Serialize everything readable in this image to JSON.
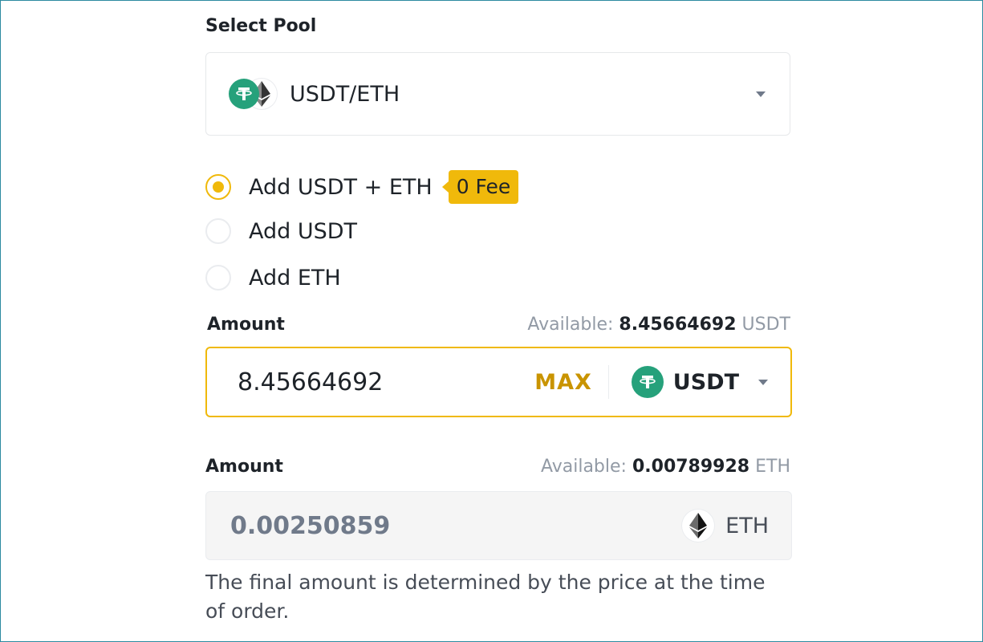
{
  "pool": {
    "label": "Select Pool",
    "selected": "USDT/ETH"
  },
  "options": [
    {
      "label": "Add USDT + ETH",
      "checked": true,
      "badge": "0 Fee"
    },
    {
      "label": "Add USDT",
      "checked": false
    },
    {
      "label": "Add ETH",
      "checked": false
    }
  ],
  "amount_usdt": {
    "label": "Amount",
    "available_prefix": "Available:",
    "available_value": "8.45664692",
    "available_unit": "USDT",
    "value": "8.45664692",
    "max_label": "MAX",
    "asset": "USDT"
  },
  "amount_eth": {
    "label": "Amount",
    "available_prefix": "Available:",
    "available_value": "0.00789928",
    "available_unit": "ETH",
    "value": "0.00250859",
    "asset": "ETH"
  },
  "note": "The final amount is determined by the price at the time of order.",
  "colors": {
    "accent": "#f0b90b",
    "usdt": "#26a17b",
    "max_text": "#c99400"
  }
}
